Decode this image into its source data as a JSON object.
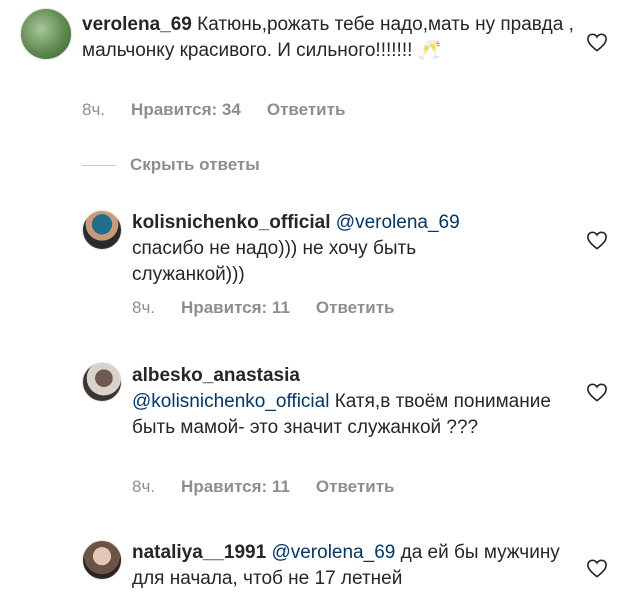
{
  "comments": [
    {
      "username": "verolena_69",
      "text": " Катюнь,рожать тебе надо,мать ну правда , мальчонку красивого. И сильного!!!!!!! ",
      "emoji": "🥂",
      "time": "8ч.",
      "likes": "Нравится: 34",
      "reply": "Ответить"
    },
    {
      "username": "kolisnichenko_official",
      "mention": " @verolena_69",
      "text": " спасибо не надо))) не хочу быть служанкой)))",
      "time": "8ч.",
      "likes": "Нравится: 11",
      "reply": "Ответить"
    },
    {
      "username": "albesko_anastasia",
      "mention": "@kolisnichenko_official",
      "text": " Катя,в твоём понимание быть мамой- это значит служанкой ???",
      "time": "8ч.",
      "likes": "Нравится: 11",
      "reply": "Ответить"
    },
    {
      "username": "nataliya__1991",
      "mention": " @verolena_69",
      "text": " да ей бы мужчину для начала, чтоб не 17 летней"
    }
  ],
  "hide_replies": "Скрыть ответы",
  "colors": {
    "secondary_text": "#8e8e8e",
    "mention": "#00376b",
    "primary_text": "#262626"
  }
}
